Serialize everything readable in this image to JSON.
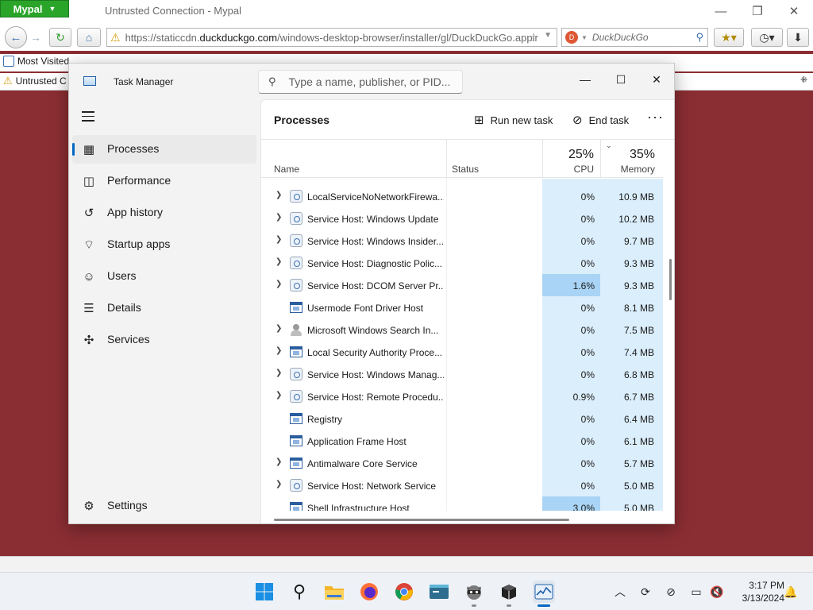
{
  "browser": {
    "app_menu": "Mypal",
    "window_title": "Untrusted Connection - Mypal",
    "url_prefix": "https://staticcdn.",
    "url_domain": "duckduckgo.com",
    "url_path": "/windows-desktop-browser/installer/gl/DuckDuckGo.appir",
    "search_engine": "DuckDuckGo",
    "bookmark_item": "Most Visited",
    "tab_label": "Untrusted C"
  },
  "task_manager": {
    "title": "Task Manager",
    "search_placeholder": "Type a name, publisher, or PID...",
    "page_title": "Processes",
    "run_new_task": "Run new task",
    "end_task": "End task",
    "nav": {
      "processes": "Processes",
      "performance": "Performance",
      "app_history": "App history",
      "startup_apps": "Startup apps",
      "users": "Users",
      "details": "Details",
      "services": "Services",
      "settings": "Settings"
    },
    "columns": {
      "name": "Name",
      "status": "Status",
      "cpu_pct": "25%",
      "cpu": "CPU",
      "memory_pct": "35%",
      "memory": "Memory"
    },
    "rows": [
      {
        "name": "LocalServiceNoNetworkFirewa...",
        "cpu": "0%",
        "memory": "10.9 MB",
        "icon": "gear",
        "expandable": true,
        "hot": false
      },
      {
        "name": "Service Host: Windows Update",
        "cpu": "0%",
        "memory": "10.2 MB",
        "icon": "gear",
        "expandable": true,
        "hot": false
      },
      {
        "name": "Service Host: Windows Insider...",
        "cpu": "0%",
        "memory": "9.7 MB",
        "icon": "gear",
        "expandable": true,
        "hot": false
      },
      {
        "name": "Service Host: Diagnostic Polic...",
        "cpu": "0%",
        "memory": "9.3 MB",
        "icon": "gear",
        "expandable": true,
        "hot": false
      },
      {
        "name": "Service Host: DCOM Server Pr...",
        "cpu": "1.6%",
        "memory": "9.3 MB",
        "icon": "gear",
        "expandable": true,
        "hot": true
      },
      {
        "name": "Usermode Font Driver Host",
        "cpu": "0%",
        "memory": "8.1 MB",
        "icon": "window",
        "expandable": false,
        "hot": false
      },
      {
        "name": "Microsoft Windows Search In...",
        "cpu": "0%",
        "memory": "7.5 MB",
        "icon": "user",
        "expandable": true,
        "hot": false
      },
      {
        "name": "Local Security Authority Proce...",
        "cpu": "0%",
        "memory": "7.4 MB",
        "icon": "window",
        "expandable": true,
        "hot": false
      },
      {
        "name": "Service Host: Windows Manag...",
        "cpu": "0%",
        "memory": "6.8 MB",
        "icon": "gear",
        "expandable": true,
        "hot": false
      },
      {
        "name": "Service Host: Remote Procedu...",
        "cpu": "0.9%",
        "memory": "6.7 MB",
        "icon": "gear",
        "expandable": true,
        "hot": false
      },
      {
        "name": "Registry",
        "cpu": "0%",
        "memory": "6.4 MB",
        "icon": "window",
        "expandable": false,
        "hot": false
      },
      {
        "name": "Application Frame Host",
        "cpu": "0%",
        "memory": "6.1 MB",
        "icon": "window",
        "expandable": false,
        "hot": false
      },
      {
        "name": "Antimalware Core Service",
        "cpu": "0%",
        "memory": "5.7 MB",
        "icon": "window",
        "expandable": true,
        "hot": false
      },
      {
        "name": "Service Host: Network Service",
        "cpu": "0%",
        "memory": "5.0 MB",
        "icon": "gear",
        "expandable": true,
        "hot": false
      },
      {
        "name": "Shell Infrastructure Host",
        "cpu": "3.0%",
        "memory": "5.0 MB",
        "icon": "window",
        "expandable": false,
        "hot": true
      }
    ]
  },
  "taskbar": {
    "time": "3:17 PM",
    "date": "3/13/2024"
  },
  "colors": {
    "accent": "#0067c0",
    "desktop_bg": "#8b2e33",
    "cpu_cell": "#dbeefc",
    "cpu_cell_hot": "#a9d4f5"
  }
}
